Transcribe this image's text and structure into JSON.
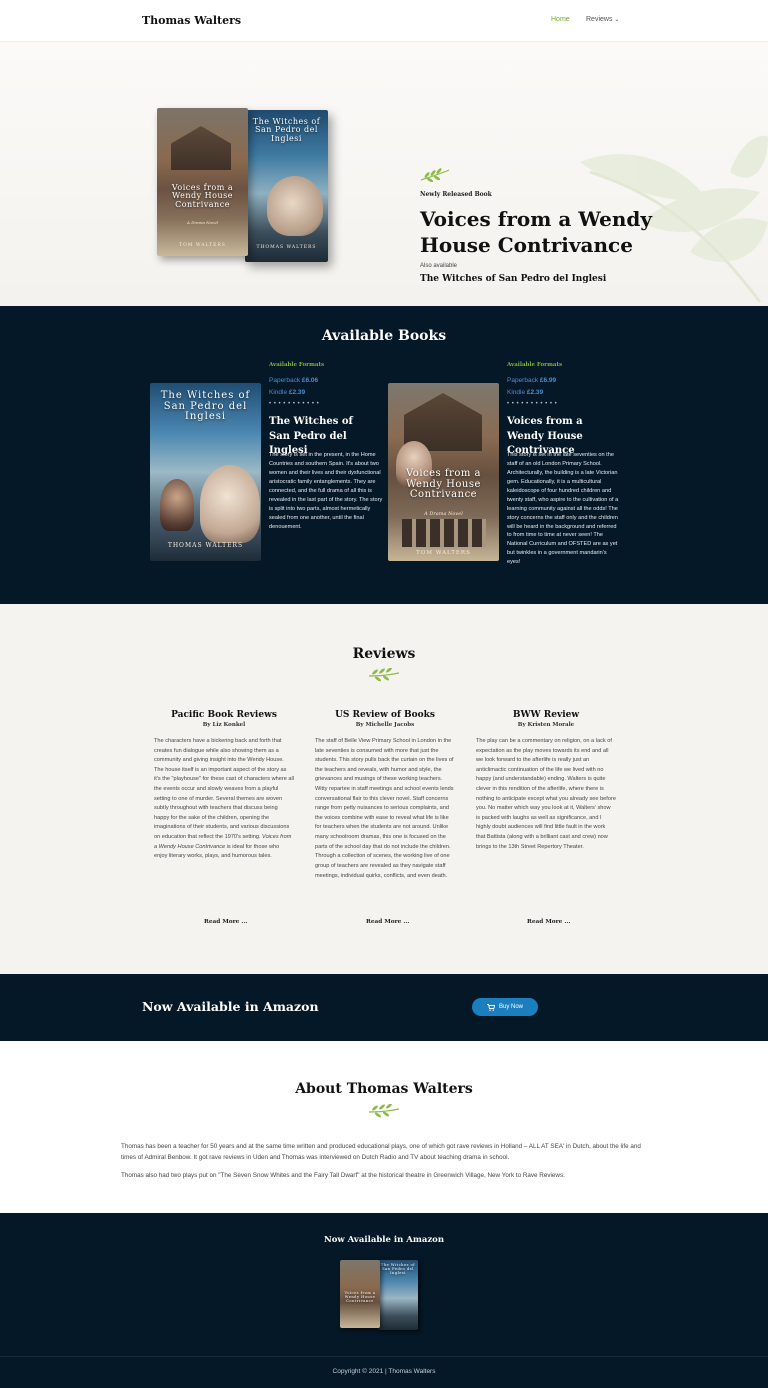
{
  "header": {
    "brand": "Thomas Walters",
    "nav": {
      "home": "Home",
      "reviews": "Reviews"
    }
  },
  "hero": {
    "kicker": "Newly Released Book",
    "title": "Voices from a Wendy House Contrivance",
    "also_label": "Also available",
    "also_title": "The Witches of San Pedro del Inglesi"
  },
  "covers": {
    "wendy": {
      "title": "Voices from a Wendy House Contrivance",
      "subtitle": "A Drama Novel",
      "author": "TOM WALTERS"
    },
    "witches": {
      "title": "The Witches of San Pedro del Inglesi",
      "author": "THOMAS WALTERS"
    }
  },
  "available": {
    "heading": "Available Books",
    "books": [
      {
        "formats_label": "Available Formats",
        "paperback_label": "Paperback",
        "paperback_price": "£6.06",
        "kindle_label": "Kindle",
        "kindle_price": "£2.39",
        "title": "The Witches of San Pedro del Inglesi",
        "description": "The story is set in the present, in the Home Countries and southern Spain. It's about two women and their lives and their dysfunctional aristocratic family entanglements. They are connected, and the full drama of all this is revealed in the last part of the story. The story is split into two parts, almost hermetically sealed from one another, until the final denouement."
      },
      {
        "formats_label": "Available Formats",
        "paperback_label": "Paperback",
        "paperback_price": "£6.99",
        "kindle_label": "Kindle",
        "kindle_price": "£2.39",
        "title": "Voices from a Wendy House Contrivance",
        "description": "This story is set in the late seventies on the staff of an old London Primary School. Architecturally, the building is a late Victorian gem. Educationally, it is a multicultural kaleidoscope of four hundred children and twenty staff, who aspire to the cultivation of a learning community against all the odds! The story concerns the staff only and the children will be heard in the background and referred to from time to time at never seen! The National Curriculum and OFSTED are as yet but twinkles in a government mandarin's eyes!"
      }
    ]
  },
  "reviews": {
    "heading": "Reviews",
    "read_more": "Read More ...",
    "items": [
      {
        "title": "Pacific Book Reviews",
        "by": "By Liz Konkel",
        "body_before": "The characters have a bickering back and forth that creates fun dialogue while also showing them as a community and giving insight into the Wendy House. The house itself is an important aspect of the story as it's the \"playhouse\" for these cast of characters where all the events occur and slowly weaves from a playful setting to one of murder. Several themes are woven subtly throughout with teachers that discuss being happy for the sake of the children, opening the imaginations of their students, and various discussions on education that reflect the 1970's setting. ",
        "body_italic": "Voices from a Wendy House Contrivance",
        "body_after": " is ideal for those who enjoy literary works, plays, and humorous tales."
      },
      {
        "title": "US Review of Books",
        "by": "By Michelle Jacobs",
        "body": "The staff of Belle View Primary School in London in the late seventies is consumed with more that just the students. This story pulls back the curtain on the lives of the teachers and reveals, with humor and style, the grievances and musings of these working teachers. Witty repartee in staff meetings and school events lends conversational flair to this clever novel. Staff concerns range from petty nuisances to serious complaints, and the voices combine with ease to reveal what life is like for teachers when the students are not around. Unlike many schoolroom dramas, this one is focused on the parts of the school day that do not include the children. Through a collection of scenes, the working live of one group of teachers are revealed as they navigate staff meetings, individual quirks, conflicts, and even death."
      },
      {
        "title": "BWW Review",
        "by": "By Kristen Morale",
        "body": "The play can be a commentary on religion, on a lack of expectation as the play moves towards its end and all we look forward to the afterlife is really just an anticlimactic continuation of the life we lived with no happy (and understandable) ending. Walters is quite clever in this rendition of the afterlife, where there is nothing to anticipate except what you already see before you. No matter which way you look at it, Walters' show is packed with laughs as well as significance, and I highly doubt audiences will find little fault in the work that Battista (along with a brilliant cast and crew) now brings to the 13th Street Repertory Theater."
      }
    ]
  },
  "amazon": {
    "text": "Now Available in Amazon",
    "button": "Buy Now"
  },
  "about": {
    "heading": "About Thomas Walters",
    "p1": "Thomas has been a teacher for 50 years and at the same time written and produced educational plays, one of which got rave reviews in Holland – ALL AT SEA' in Dutch, about the life and times of Admiral Benbow. It got rave reviews in Uden and Thomas was interviewed on Dutch Radio and TV about teaching drama in school.",
    "p2": "Thomas also had two plays put on \"The Seven Snow Whites and the Fairy Tall Dwarf\" at the historical theatre in Greenwich Village, New York to Rave Reviews."
  },
  "footer": {
    "title": "Now Available in Amazon",
    "copyright": "Copyright © 2021 | Thomas Walters"
  },
  "colors": {
    "accent_green": "#76a82f",
    "navy": "#051827",
    "button_blue": "#1b7fbf"
  }
}
